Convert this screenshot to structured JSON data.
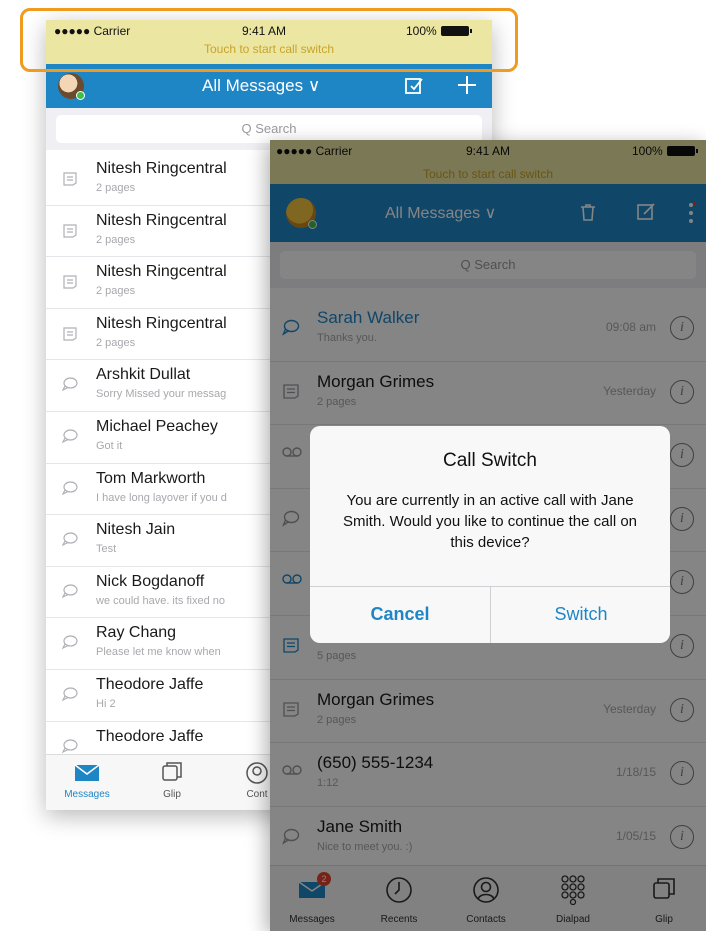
{
  "back_phone": {
    "status": {
      "carrier": "●●●●● Carrier",
      "time": "9:41 AM",
      "battery": "100%",
      "banner": "Touch to start call switch"
    },
    "nav": {
      "title": "All Messages ∨"
    },
    "search": {
      "placeholder": "Q Search"
    },
    "messages": [
      {
        "name": "Nitesh Ringcentral",
        "sub": "2 pages",
        "icon": "fax-icon"
      },
      {
        "name": "Nitesh Ringcentral",
        "sub": "2 pages",
        "icon": "fax-icon"
      },
      {
        "name": "Nitesh Ringcentral",
        "sub": "2 pages",
        "icon": "fax-icon"
      },
      {
        "name": "Nitesh Ringcentral",
        "sub": "2 pages",
        "icon": "fax-icon"
      },
      {
        "name": "Arshkit Dullat",
        "sub": "Sorry Missed your messag",
        "icon": "chat-bubble-icon"
      },
      {
        "name": "Michael Peachey",
        "sub": "Got it",
        "icon": "chat-bubble-icon"
      },
      {
        "name": "Tom Markworth",
        "sub": "I have long layover if you d",
        "icon": "chat-bubble-icon"
      },
      {
        "name": "Nitesh Jain",
        "sub": "Test",
        "icon": "chat-bubble-icon"
      },
      {
        "name": "Nick Bogdanoff",
        "sub": "we could have. its fixed no",
        "icon": "chat-bubble-icon"
      },
      {
        "name": "Ray Chang",
        "sub": "Please let me know when",
        "icon": "chat-bubble-icon"
      },
      {
        "name": "Theodore Jaffe",
        "sub": "Hi 2",
        "icon": "chat-bubble-icon"
      },
      {
        "name": "Theodore Jaffe",
        "sub": "",
        "icon": "chat-bubble-icon"
      }
    ],
    "tabs": [
      {
        "label": "Messages",
        "icon": "envelope-icon"
      },
      {
        "label": "Glip",
        "icon": "glip-icon"
      },
      {
        "label": "Cont",
        "icon": "contacts-icon"
      }
    ]
  },
  "front_phone": {
    "status": {
      "carrier": "●●●●● Carrier",
      "time": "9:41 AM",
      "battery": "100%",
      "banner": "Touch to start call switch"
    },
    "nav": {
      "title": "All Messages ∨"
    },
    "search": {
      "placeholder": "Q Search"
    },
    "messages": [
      {
        "name": "Sarah Walker",
        "sub": "Thanks you.",
        "time": "09:08 am",
        "icon": "chat-bubble-icon",
        "unread": true
      },
      {
        "name": "Morgan Grimes",
        "sub": "2 pages",
        "time": "Yesterday",
        "icon": "fax-icon",
        "unread": false
      },
      {
        "name": "",
        "sub": "",
        "time": "",
        "icon": "voicemail-icon",
        "unread": false
      },
      {
        "name": "",
        "sub": "",
        "time": "",
        "icon": "chat-bubble-icon",
        "unread": false
      },
      {
        "name": "",
        "sub": "",
        "time": "",
        "icon": "voicemail-icon",
        "unread": false
      },
      {
        "name": "",
        "sub": "5 pages",
        "time": "",
        "icon": "fax-icon",
        "unread": true
      },
      {
        "name": "Morgan Grimes",
        "sub": "2 pages",
        "time": "Yesterday",
        "icon": "fax-icon",
        "unread": false
      },
      {
        "name": "(650) 555-1234",
        "sub": "1:12",
        "time": "1/18/15",
        "icon": "voicemail-icon",
        "unread": false
      },
      {
        "name": "Jane Smith",
        "sub": "Nice to meet you. :)",
        "time": "1/05/15",
        "icon": "chat-bubble-icon",
        "unread": false
      }
    ],
    "tabs": [
      {
        "label": "Messages",
        "icon": "envelope-icon",
        "badge": "2"
      },
      {
        "label": "Recents",
        "icon": "clock-icon"
      },
      {
        "label": "Contacts",
        "icon": "contacts-icon"
      },
      {
        "label": "Dialpad",
        "icon": "dialpad-icon"
      },
      {
        "label": "Glip",
        "icon": "glip-icon"
      }
    ]
  },
  "dialog": {
    "title": "Call Switch",
    "message": "You are currently in an active call with Jane Smith. Would you like to continue the call on this device?",
    "cancel_label": "Cancel",
    "switch_label": "Switch"
  },
  "colors": {
    "brand_blue": "#1f86c6",
    "banner_bg": "#ece6a3",
    "banner_text": "#c9a329",
    "highlight": "#f09a1f",
    "badge": "#e8412d"
  }
}
